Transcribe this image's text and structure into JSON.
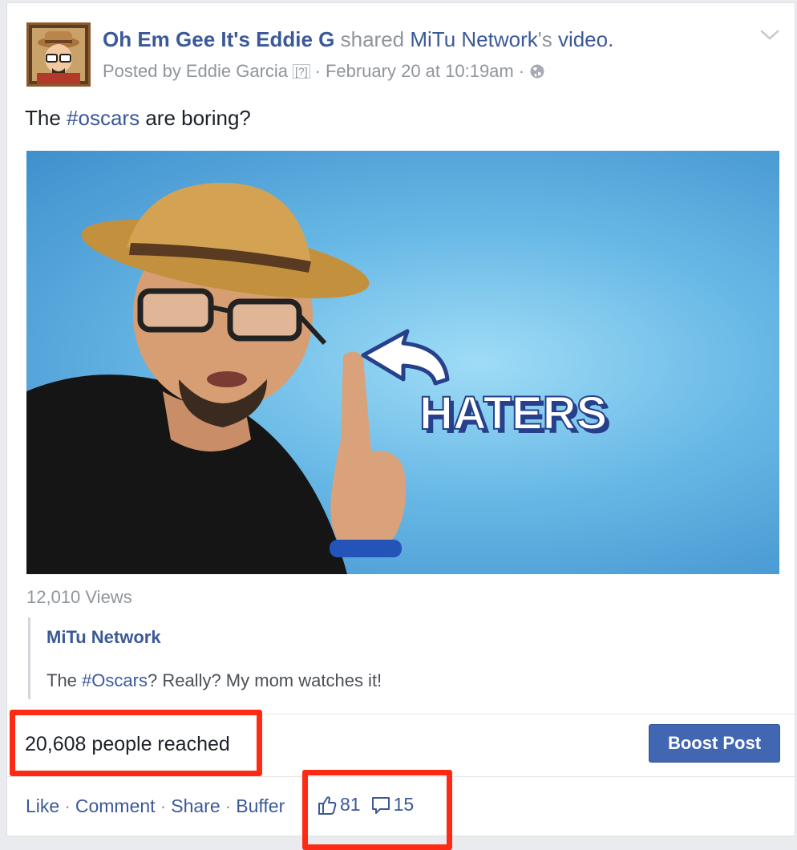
{
  "post": {
    "author": "Oh Em Gee It's Eddie G",
    "shared_word": "shared",
    "shared_source": "MiTu Network",
    "shared_suffix": "'s",
    "shared_object": "video.",
    "posted_by_prefix": "Posted by",
    "posted_by_name": "Eddie Garcia",
    "posted_by_badge": "[?]",
    "separator": "·",
    "timestamp": "February 20 at 10:19am",
    "text_before": "The",
    "hashtag": "#oscars",
    "text_after": "are boring?",
    "video_overlay_text": "HATERS",
    "views": "12,010 Views"
  },
  "attachment": {
    "title": "MiTu Network",
    "text_before": "The",
    "hashtag": "#Oscars",
    "text_after": "? Really? My mom watches it!"
  },
  "insights": {
    "reach": "20,608 people reached",
    "boost_label": "Boost Post"
  },
  "actions": {
    "like": "Like",
    "comment": "Comment",
    "share": "Share",
    "buffer": "Buffer",
    "separator": "·",
    "like_count": "81",
    "comment_count": "15"
  },
  "icons": {
    "menu": "chevron-down-icon",
    "privacy": "globe-icon",
    "like": "thumbs-up-icon",
    "comment": "comment-bubble-icon"
  },
  "colors": {
    "link": "#3b5998",
    "muted": "#90949c",
    "boost": "#4267b2",
    "highlight": "#ff2a14"
  }
}
